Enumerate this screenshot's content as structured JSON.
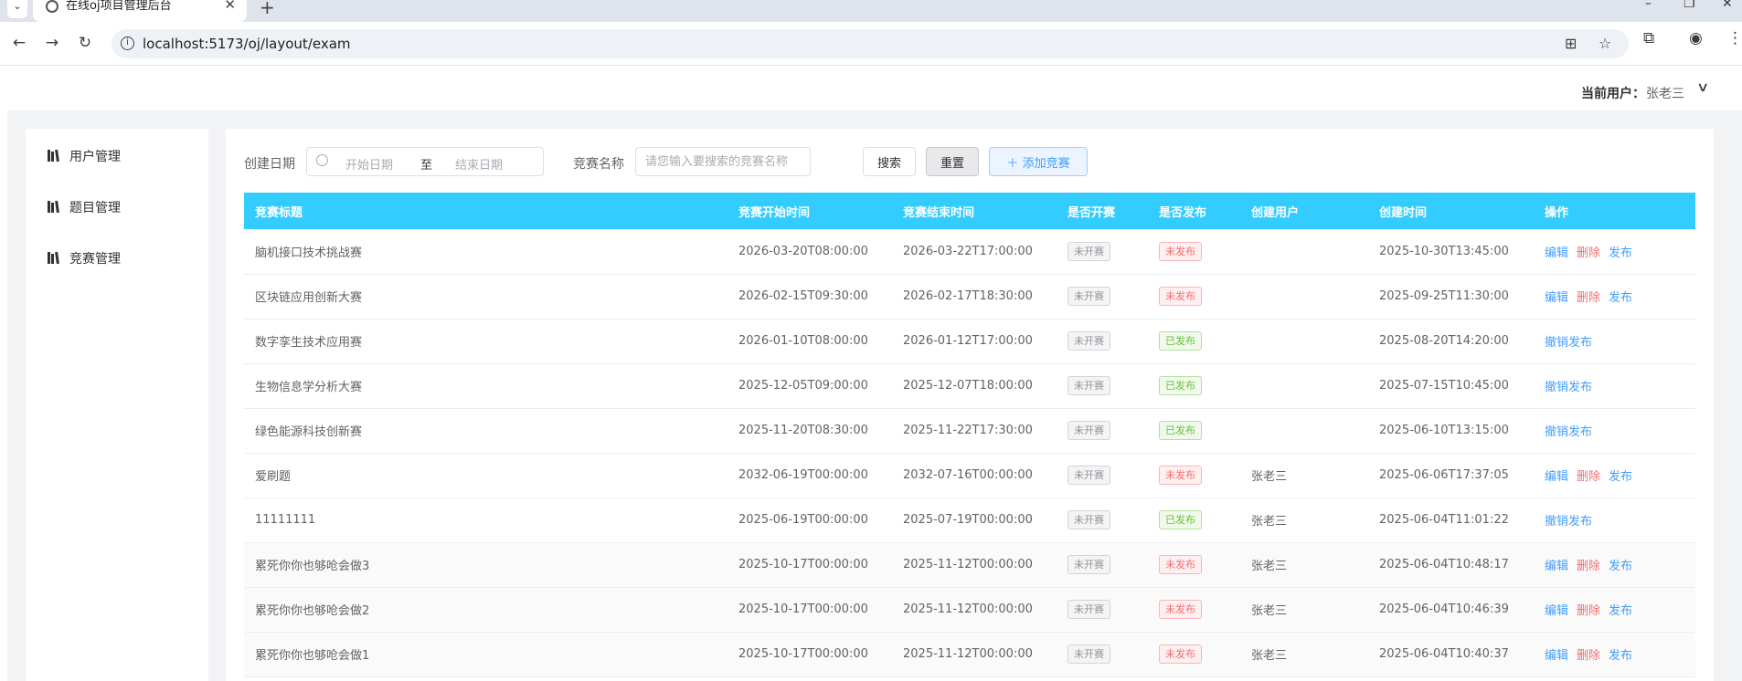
{
  "browser": {
    "tab_title": "在线oj项目管理后台",
    "url": "localhost:5173/oj/layout/exam"
  },
  "header": {
    "user_label": "当前用户：",
    "user_name": "张老三"
  },
  "sidebar": {
    "items": [
      {
        "label": "用户管理"
      },
      {
        "label": "题目管理"
      },
      {
        "label": "竞赛管理"
      }
    ]
  },
  "filter": {
    "date_label": "创建日期",
    "start_placeholder": "开始日期",
    "range_separator": "至",
    "end_placeholder": "结束日期",
    "name_label": "竞赛名称",
    "name_placeholder": "请您输入要搜索的竞赛名称",
    "search_label": "搜索",
    "reset_label": "重置",
    "add_label": "添加竞赛"
  },
  "table": {
    "columns": [
      "竞赛标题",
      "竞赛开始时间",
      "竞赛结束时间",
      "是否开赛",
      "是否发布",
      "创建用户",
      "创建时间",
      "操作"
    ],
    "rows": [
      {
        "title": "脑机接口技术挑战赛",
        "start": "2026-03-20T08:00:00",
        "end": "2026-03-22T17:00:00",
        "started": "未开赛",
        "published": "未发布",
        "creator": "",
        "created": "2025-10-30T13:45:00",
        "actions": [
          "编辑",
          "删除",
          "发布"
        ]
      },
      {
        "title": "区块链应用创新大赛",
        "start": "2026-02-15T09:30:00",
        "end": "2026-02-17T18:30:00",
        "started": "未开赛",
        "published": "未发布",
        "creator": "",
        "created": "2025-09-25T11:30:00",
        "actions": [
          "编辑",
          "删除",
          "发布"
        ]
      },
      {
        "title": "数字孪生技术应用赛",
        "start": "2026-01-10T08:00:00",
        "end": "2026-01-12T17:00:00",
        "started": "未开赛",
        "published": "已发布",
        "creator": "",
        "created": "2025-08-20T14:20:00",
        "actions": [
          "撤销发布"
        ]
      },
      {
        "title": "生物信息学分析大赛",
        "start": "2025-12-05T09:00:00",
        "end": "2025-12-07T18:00:00",
        "started": "未开赛",
        "published": "已发布",
        "creator": "",
        "created": "2025-07-15T10:45:00",
        "actions": [
          "撤销发布"
        ]
      },
      {
        "title": "绿色能源科技创新赛",
        "start": "2025-11-20T08:30:00",
        "end": "2025-11-22T17:30:00",
        "started": "未开赛",
        "published": "已发布",
        "creator": "",
        "created": "2025-06-10T13:15:00",
        "actions": [
          "撤销发布"
        ]
      },
      {
        "title": "爱刷题",
        "start": "2032-06-19T00:00:00",
        "end": "2032-07-16T00:00:00",
        "started": "未开赛",
        "published": "未发布",
        "creator": "张老三",
        "created": "2025-06-06T17:37:05",
        "actions": [
          "编辑",
          "删除",
          "发布"
        ]
      },
      {
        "title": "11111111",
        "start": "2025-06-19T00:00:00",
        "end": "2025-07-19T00:00:00",
        "started": "未开赛",
        "published": "已发布",
        "creator": "张老三",
        "created": "2025-06-04T11:01:22",
        "actions": [
          "撤销发布"
        ]
      },
      {
        "title": "累死你你也够呛会做3",
        "start": "2025-10-17T00:00:00",
        "end": "2025-11-12T00:00:00",
        "started": "未开赛",
        "published": "未发布",
        "creator": "张老三",
        "created": "2025-06-04T10:48:17",
        "actions": [
          "编辑",
          "删除",
          "发布"
        ]
      },
      {
        "title": "累死你你也够呛会做2",
        "start": "2025-10-17T00:00:00",
        "end": "2025-11-12T00:00:00",
        "started": "未开赛",
        "published": "未发布",
        "creator": "张老三",
        "created": "2025-06-04T10:46:39",
        "actions": [
          "编辑",
          "删除",
          "发布"
        ]
      },
      {
        "title": "累死你你也够呛会做1",
        "start": "2025-10-17T00:00:00",
        "end": "2025-11-12T00:00:00",
        "started": "未开赛",
        "published": "未发布",
        "creator": "张老三",
        "created": "2025-06-04T10:40:37",
        "actions": [
          "编辑",
          "删除",
          "发布"
        ]
      }
    ]
  },
  "colors": {
    "table_header": "#33ccff",
    "link_blue": "#409eff",
    "danger_red": "#f56c6c",
    "success_green": "#67c23a"
  }
}
